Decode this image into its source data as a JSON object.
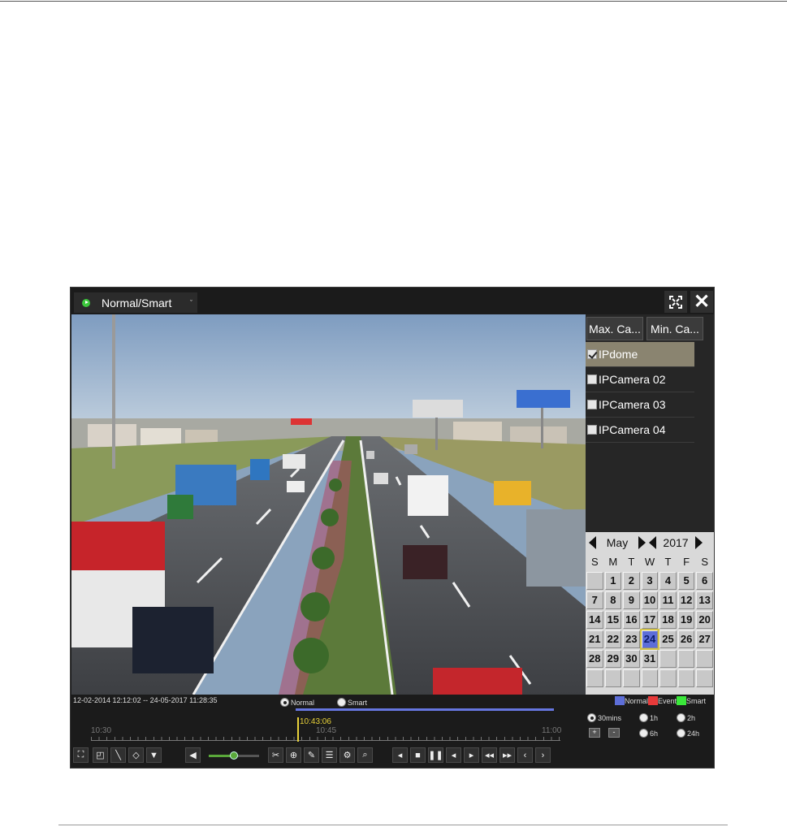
{
  "titlebar": {
    "mode_label": "Normal/Smart",
    "mode_caret": "ˇ",
    "close_glyph": "✕"
  },
  "right_panel": {
    "max_camera_label": "Max. Ca...",
    "min_camera_label": "Min. Ca...",
    "cameras": [
      {
        "label": "IPdome",
        "checked": true
      },
      {
        "label": "IPCamera 02",
        "checked": false
      },
      {
        "label": "IPCamera 03",
        "checked": false
      },
      {
        "label": "IPCamera 04",
        "checked": false
      }
    ]
  },
  "calendar": {
    "month": "May",
    "year": "2017",
    "weekdays": [
      "S",
      "M",
      "T",
      "W",
      "T",
      "F",
      "S"
    ],
    "days": [
      "",
      "1",
      "2",
      "3",
      "4",
      "5",
      "6",
      "7",
      "8",
      "9",
      "10",
      "11",
      "12",
      "13",
      "14",
      "15",
      "16",
      "17",
      "18",
      "19",
      "20",
      "21",
      "22",
      "23",
      "24",
      "25",
      "26",
      "27",
      "28",
      "29",
      "30",
      "31",
      "",
      "",
      "",
      "",
      "",
      "",
      "",
      "",
      "",
      ""
    ],
    "selected_day": "24"
  },
  "timeline": {
    "range_text": "12-02-2014 12:12:02 -- 24-05-2017 11:28:35",
    "mode_normal": "Normal",
    "mode_smart": "Smart",
    "mode_selected": "Normal",
    "legend": [
      {
        "label": "Normal",
        "color": "#5d6ed8"
      },
      {
        "label": "Event",
        "color": "#e83a3a"
      },
      {
        "label": "Smart",
        "color": "#3ae83a"
      }
    ],
    "tick_labels": [
      "10:30",
      "10:45",
      "11:00"
    ],
    "cursor_time": "10:43:06",
    "span_options": [
      "30mins",
      "1h",
      "2h",
      "6h",
      "24h"
    ],
    "span_selected": "30mins",
    "zoom_in_label": "+",
    "zoom_out_label": "-"
  },
  "toolbar": {
    "volume_level": 0.5,
    "icons": [
      "fullscreen-icon",
      "zoom-region-icon",
      "line-draw-icon",
      "ptz-icon",
      "filter-icon",
      "audio-icon",
      "clip-icon",
      "add-tag-icon",
      "custom-tag-icon",
      "tag-manage-icon",
      "settings-icon",
      "smart-search-icon",
      "reverse-play-icon",
      "stop-icon",
      "pause-icon",
      "back-30s-icon",
      "forward-30s-icon",
      "slow-icon",
      "fast-icon",
      "prev-day-icon",
      "next-day-icon"
    ]
  },
  "colors": {
    "accent_blue": "#5d6ed8",
    "cursor_yellow": "#e8d23a",
    "window_bg": "#1b1b1b",
    "selected_row": "#8a8470"
  }
}
